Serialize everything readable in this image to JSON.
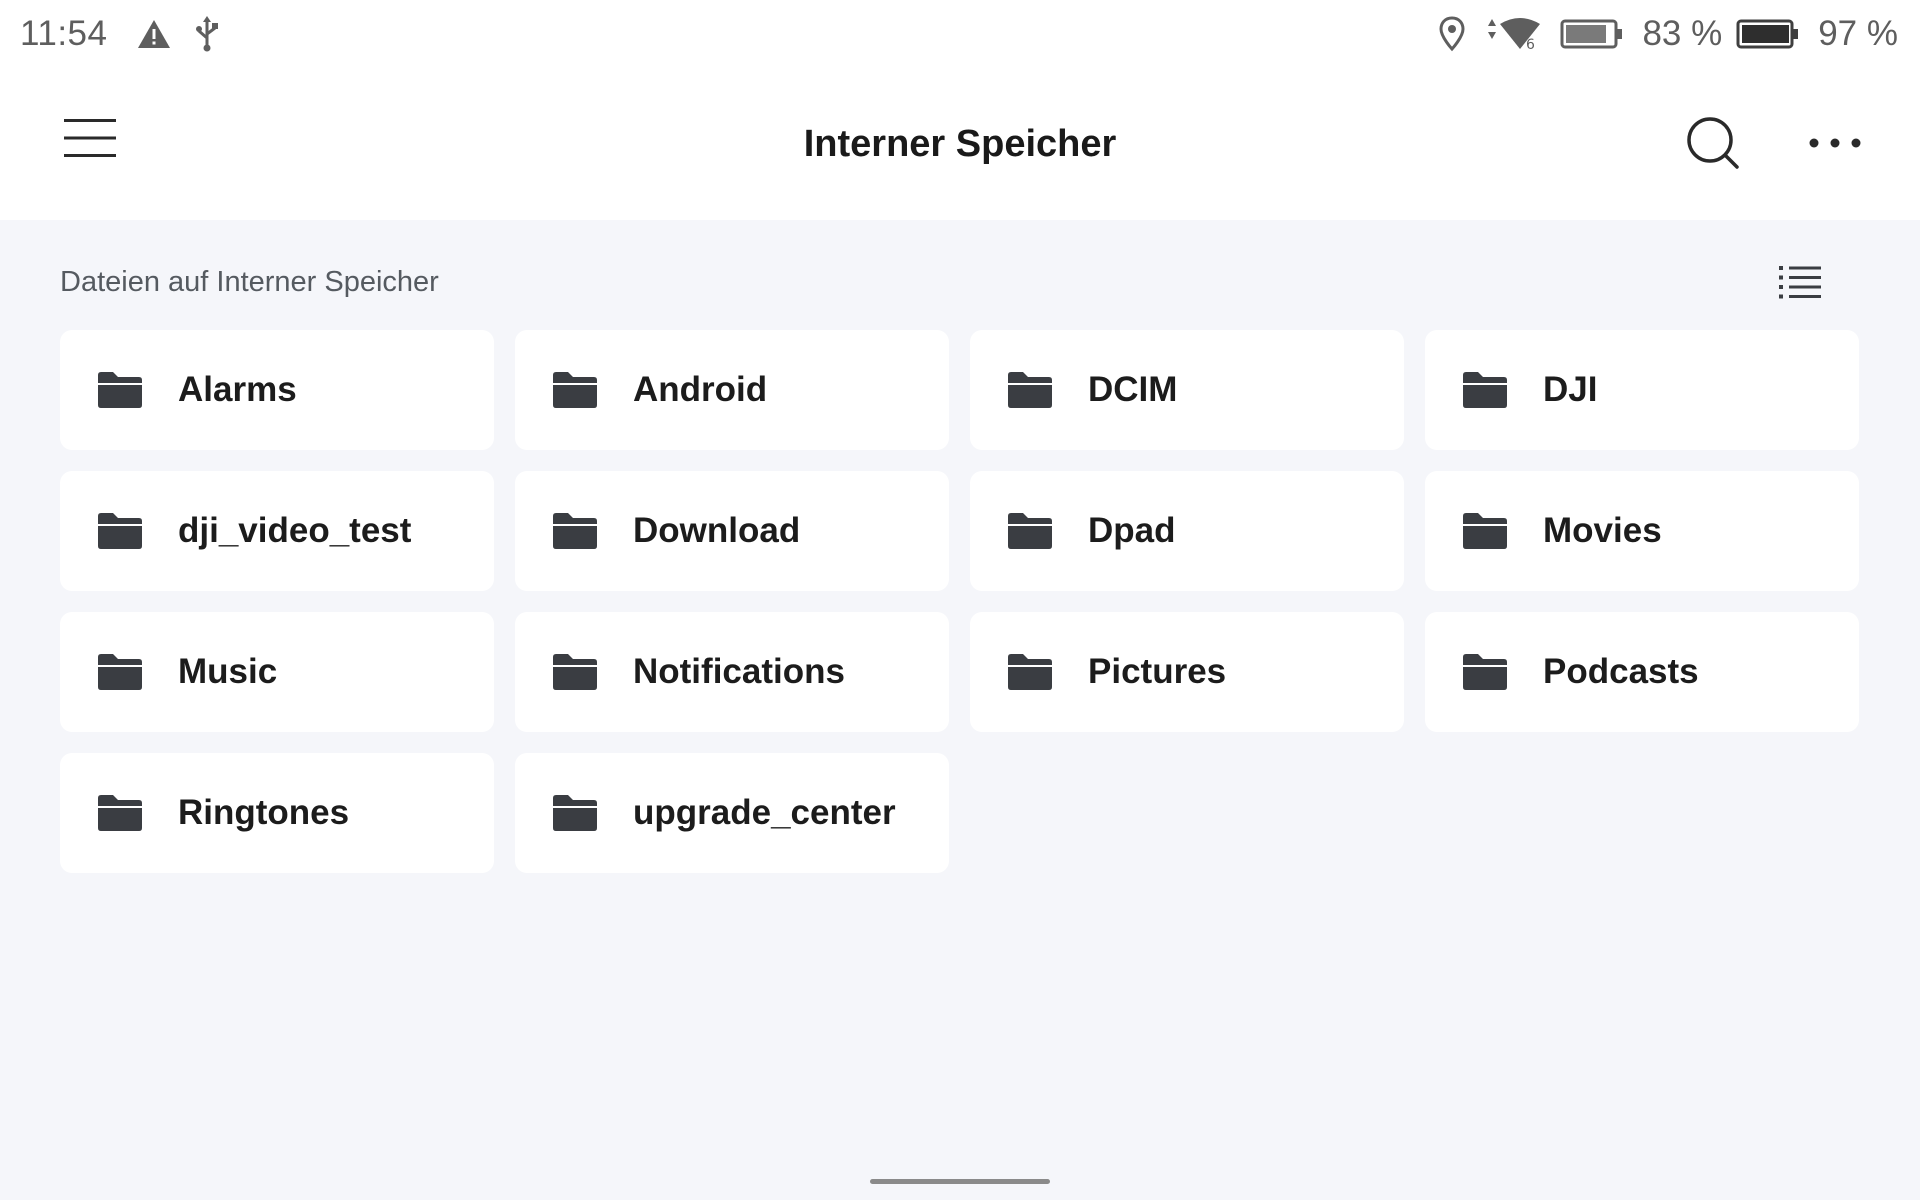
{
  "status_bar": {
    "time": "11:54",
    "left_icons": [
      "warning-icon",
      "usb-icon"
    ],
    "right_icons": [
      "location-icon",
      "wifi-icon",
      "battery-icon"
    ],
    "battery_1_percent": "83 %",
    "battery_2_percent": "97 %"
  },
  "app_bar": {
    "title": "Interner Speicher",
    "icons": [
      "menu-icon",
      "search-icon",
      "more-icon"
    ]
  },
  "content": {
    "section_label": "Dateien auf Interner Speicher",
    "view_toggle_icon": "list-view-icon",
    "folders": [
      {
        "name": "Alarms"
      },
      {
        "name": "Android"
      },
      {
        "name": "DCIM"
      },
      {
        "name": "DJI"
      },
      {
        "name": "dji_video_test"
      },
      {
        "name": "Download"
      },
      {
        "name": "Dpad"
      },
      {
        "name": "Movies"
      },
      {
        "name": "Music"
      },
      {
        "name": "Notifications"
      },
      {
        "name": "Pictures"
      },
      {
        "name": "Podcasts"
      },
      {
        "name": "Ringtones"
      },
      {
        "name": "upgrade_center"
      }
    ]
  },
  "colors": {
    "background": "#f5f6fa",
    "card": "#ffffff",
    "text": "#1c1c1c",
    "icon": "#3a3d42"
  }
}
